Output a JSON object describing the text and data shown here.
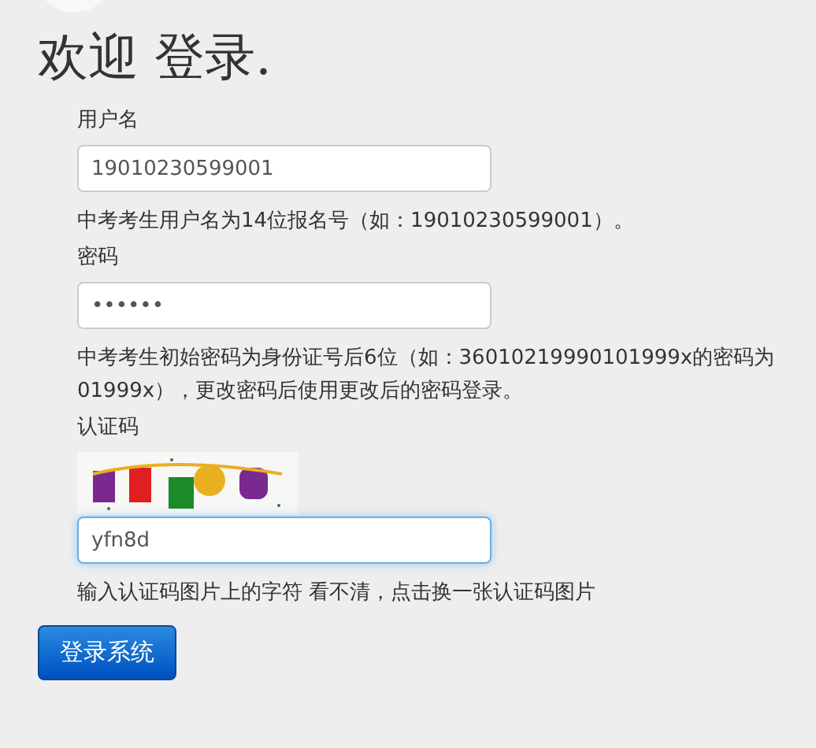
{
  "title": "欢迎 登录.",
  "fields": [
    {
      "kind": "text",
      "label": "用户名",
      "value": "19010230599001",
      "focused": false,
      "hint": "中考考生用户名为14位报名号（如：19010230599001）。"
    },
    {
      "kind": "text",
      "label": "密码",
      "value": "••••••",
      "focused": false,
      "hint": "中考考生初始密码为身份证号后6位（如：36010219990101999x的密码为01999x），更改密码后使用更改后的密码登录。"
    },
    {
      "kind": "captcha",
      "label": "认证码",
      "value": "yfn8d",
      "focused": true,
      "hint": "输入认证码图片上的字符 看不清，点击换一张认证码图片"
    }
  ],
  "submit": "登录系统"
}
